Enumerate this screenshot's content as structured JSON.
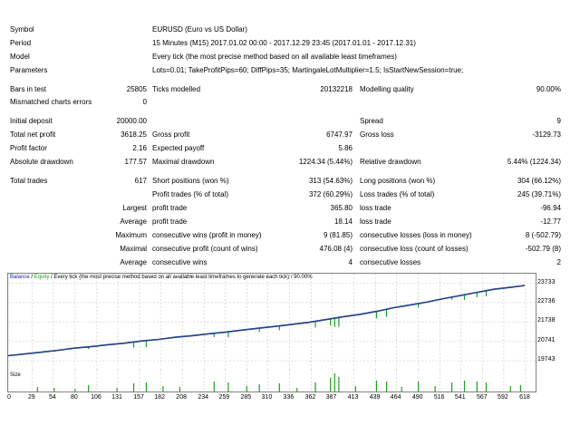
{
  "report": {
    "symbol": {
      "label": "Symbol",
      "value": "EURUSD (Euro vs US Dollar)"
    },
    "period": {
      "label": "Period",
      "value": "15 Minutes (M15) 2017.01.02 00:00 - 2017.12.29 23:45 (2017.01.01 - 2017.12.31)"
    },
    "model": {
      "label": "Model",
      "value": "Every tick (the most precise method based on all available least timeframes)"
    },
    "parameters": {
      "label": "Parameters",
      "value": "Lots=0.01; TakeProfitPips=60; DiffPips=35; MartingaleLotMultiplier=1.5; IsStartNewSession=true;"
    },
    "bars_in_test": {
      "label": "Bars in test",
      "value": "25805"
    },
    "ticks_modelled": {
      "label": "Ticks modelled",
      "value": "20132218"
    },
    "modelling_quality": {
      "label": "Modelling quality",
      "value": "90.00%"
    },
    "mismatched": {
      "label": "Mismatched charts errors",
      "value": "0"
    },
    "initial_deposit": {
      "label": "Initial deposit",
      "value": "20000.00"
    },
    "spread": {
      "label": "Spread",
      "value": "9"
    },
    "total_net_profit": {
      "label": "Total net profit",
      "value": "3618.25"
    },
    "gross_profit": {
      "label": "Gross profit",
      "value": "6747.97"
    },
    "gross_loss": {
      "label": "Gross loss",
      "value": "-3129.73"
    },
    "profit_factor": {
      "label": "Profit factor",
      "value": "2.16"
    },
    "expected_payoff": {
      "label": "Expected payoff",
      "value": "5.86"
    },
    "absolute_drawdown": {
      "label": "Absolute drawdown",
      "value": "177.57"
    },
    "maximal_drawdown": {
      "label": "Maximal drawdown",
      "value": "1224.34 (5.44%)"
    },
    "relative_drawdown": {
      "label": "Relative drawdown",
      "value": "5.44% (1224.34)"
    },
    "total_trades": {
      "label": "Total trades",
      "value": "617"
    },
    "short_positions": {
      "label": "Short positions (won %)",
      "value": "313 (54.63%)"
    },
    "long_positions": {
      "label": "Long positions (won %)",
      "value": "304 (66.12%)"
    },
    "profit_trades": {
      "label": "Profit trades (% of total)",
      "value": "372 (60.29%)"
    },
    "loss_trades": {
      "label": "Loss trades (% of total)",
      "value": "245 (39.71%)"
    },
    "largest_label": "Largest",
    "largest_profit": {
      "label": "profit trade",
      "value": "365.80"
    },
    "largest_loss": {
      "label": "loss trade",
      "value": "-96.94"
    },
    "average_label": "Average",
    "average_profit": {
      "label": "profit trade",
      "value": "18.14"
    },
    "average_loss": {
      "label": "loss trade",
      "value": "-12.77"
    },
    "maximum_label": "Maximum",
    "max_cons_wins": {
      "label": "consecutive wins (profit in money)",
      "value": "9 (81.85)"
    },
    "max_cons_losses": {
      "label": "consecutive losses (loss in money)",
      "value": "8 (-502.79)"
    },
    "maximal_label": "Maximal",
    "maximal_cons_profit": {
      "label": "consecutive profit (count of wins)",
      "value": "476.08 (4)"
    },
    "maximal_cons_loss": {
      "label": "consecutive loss (count of losses)",
      "value": "-502.79 (8)"
    },
    "average2_label": "Average",
    "avg_cons_wins": {
      "label": "consecutive wins",
      "value": "4"
    },
    "avg_cons_losses": {
      "label": "consecutive losses",
      "value": "2"
    }
  },
  "graph": {
    "legend_balance": "Balance",
    "legend_sep": " / ",
    "legend_equity": "Equity",
    "legend_rest": " / Every tick (the most precise method based on all available least timeframes to generate each tick) / 90.00%",
    "size_label": "Size",
    "colors": {
      "balance": "#1a1aa6",
      "equity": "#1e9e1e",
      "size": "#1e9e1e",
      "grid": "#c8c8c8"
    }
  },
  "chart_data": {
    "type": "line",
    "title": "",
    "xlabel": "",
    "ylabel": "",
    "x_ticks": [
      0,
      29,
      54,
      80,
      106,
      131,
      157,
      182,
      208,
      234,
      259,
      285,
      310,
      336,
      362,
      387,
      413,
      439,
      464,
      490,
      516,
      541,
      567,
      592,
      618
    ],
    "y_ticks": [
      23733,
      22736,
      21738,
      20741,
      19743
    ],
    "ylim": [
      19650,
      23850
    ],
    "xlim": [
      0,
      630
    ],
    "series": [
      {
        "name": "Balance",
        "x": [
          0,
          20,
          40,
          60,
          80,
          100,
          120,
          140,
          160,
          180,
          200,
          220,
          240,
          260,
          280,
          300,
          320,
          340,
          360,
          380,
          400,
          420,
          440,
          460,
          480,
          500,
          520,
          540,
          560,
          580,
          600,
          617
        ],
        "values": [
          20000,
          20090,
          20180,
          20280,
          20390,
          20470,
          20570,
          20650,
          20760,
          20840,
          20950,
          21030,
          21130,
          21220,
          21320,
          21420,
          21510,
          21620,
          21720,
          21860,
          22000,
          22130,
          22280,
          22470,
          22610,
          22760,
          22940,
          23100,
          23260,
          23420,
          23520,
          23618
        ]
      },
      {
        "name": "Equity",
        "dips": [
          {
            "x": 55,
            "y": 20200
          },
          {
            "x": 60,
            "y": 20250
          },
          {
            "x": 96,
            "y": 20340
          },
          {
            "x": 150,
            "y": 20420
          },
          {
            "x": 165,
            "y": 20440
          },
          {
            "x": 246,
            "y": 20960
          },
          {
            "x": 263,
            "y": 20950
          },
          {
            "x": 300,
            "y": 21220
          },
          {
            "x": 324,
            "y": 21310
          },
          {
            "x": 367,
            "y": 21450
          },
          {
            "x": 385,
            "y": 21560
          },
          {
            "x": 390,
            "y": 21480
          },
          {
            "x": 395,
            "y": 21490
          },
          {
            "x": 440,
            "y": 21930
          },
          {
            "x": 452,
            "y": 22000
          },
          {
            "x": 490,
            "y": 22480
          },
          {
            "x": 530,
            "y": 22880
          },
          {
            "x": 545,
            "y": 22870
          },
          {
            "x": 560,
            "y": 23010
          },
          {
            "x": 571,
            "y": 23060
          }
        ]
      }
    ],
    "size_bars": [
      {
        "x": 35,
        "h": 0.25
      },
      {
        "x": 55,
        "h": 0.2
      },
      {
        "x": 80,
        "h": 0.15
      },
      {
        "x": 96,
        "h": 0.35
      },
      {
        "x": 130,
        "h": 0.2
      },
      {
        "x": 150,
        "h": 0.45
      },
      {
        "x": 165,
        "h": 0.5
      },
      {
        "x": 185,
        "h": 0.3
      },
      {
        "x": 205,
        "h": 0.25
      },
      {
        "x": 246,
        "h": 0.55
      },
      {
        "x": 263,
        "h": 0.5
      },
      {
        "x": 285,
        "h": 0.3
      },
      {
        "x": 300,
        "h": 0.4
      },
      {
        "x": 324,
        "h": 0.45
      },
      {
        "x": 345,
        "h": 0.2
      },
      {
        "x": 367,
        "h": 0.5
      },
      {
        "x": 385,
        "h": 0.75
      },
      {
        "x": 390,
        "h": 1.0
      },
      {
        "x": 395,
        "h": 0.8
      },
      {
        "x": 415,
        "h": 0.3
      },
      {
        "x": 440,
        "h": 0.6
      },
      {
        "x": 452,
        "h": 0.55
      },
      {
        "x": 470,
        "h": 0.25
      },
      {
        "x": 490,
        "h": 0.55
      },
      {
        "x": 510,
        "h": 0.3
      },
      {
        "x": 530,
        "h": 0.5
      },
      {
        "x": 545,
        "h": 0.6
      },
      {
        "x": 560,
        "h": 0.55
      },
      {
        "x": 571,
        "h": 0.5
      },
      {
        "x": 600,
        "h": 0.3
      },
      {
        "x": 612,
        "h": 0.35
      }
    ]
  }
}
